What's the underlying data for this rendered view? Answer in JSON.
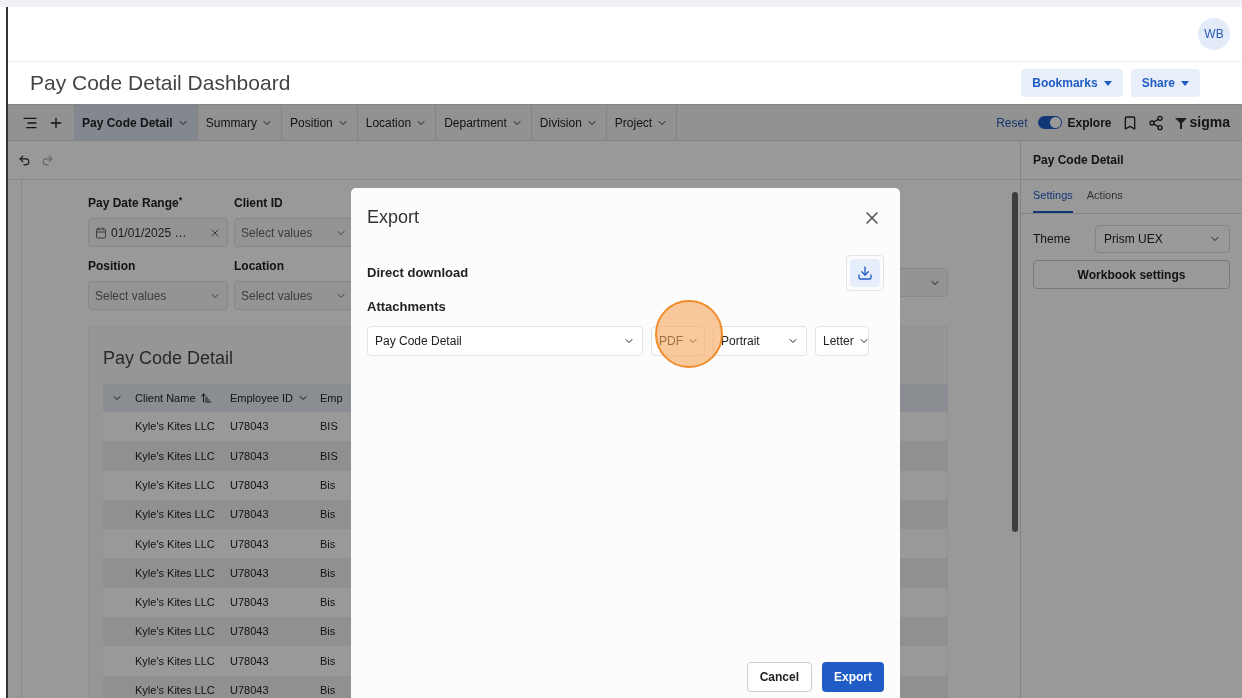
{
  "header": {
    "avatar": "WB"
  },
  "title": "Pay Code Detail Dashboard",
  "header_buttons": [
    "Bookmarks",
    "Share"
  ],
  "toolbar": {
    "tabs": [
      {
        "label": "Pay Code Detail",
        "selected": true
      },
      {
        "label": "Summary",
        "selected": false
      },
      {
        "label": "Position",
        "selected": false
      },
      {
        "label": "Location",
        "selected": false
      },
      {
        "label": "Department",
        "selected": false
      },
      {
        "label": "Division",
        "selected": false
      },
      {
        "label": "Project",
        "selected": false
      }
    ],
    "reset": "Reset",
    "explore": {
      "label": "Explore",
      "on": true
    },
    "logo": "sigma"
  },
  "filters": [
    {
      "kind": "date",
      "label": "Pay Date Range",
      "required_mark": "*",
      "value": "01/01/2025 …"
    },
    {
      "kind": "select",
      "label": "Client ID",
      "placeholder": "Select values"
    },
    {
      "kind": "select",
      "label": "Position",
      "placeholder": "Select values"
    },
    {
      "kind": "select",
      "label": "Location",
      "placeholder": "Select values"
    }
  ],
  "table": {
    "title": "Pay Code Detail",
    "columns": [
      {
        "kind": "menu"
      },
      {
        "kind": "sorted",
        "label": "Client Name"
      },
      {
        "kind": "menu",
        "label": "Employee ID"
      },
      {
        "kind": "plain",
        "label": "Emp"
      }
    ],
    "rows": [
      {
        "client_name": "Kyle's Kites LLC",
        "employee_id": "U78043",
        "column_4": "BIS"
      },
      {
        "client_name": "Kyle's Kites LLC",
        "employee_id": "U78043",
        "column_4": "BIS"
      },
      {
        "client_name": "Kyle's Kites LLC",
        "employee_id": "U78043",
        "column_4": "Bis"
      },
      {
        "client_name": "Kyle's Kites LLC",
        "employee_id": "U78043",
        "column_4": "Bis"
      },
      {
        "client_name": "Kyle's Kites LLC",
        "employee_id": "U78043",
        "column_4": "Bis"
      },
      {
        "client_name": "Kyle's Kites LLC",
        "employee_id": "U78043",
        "column_4": "Bis"
      },
      {
        "client_name": "Kyle's Kites LLC",
        "employee_id": "U78043",
        "column_4": "Bis"
      },
      {
        "client_name": "Kyle's Kites LLC",
        "employee_id": "U78043",
        "column_4": "Bis"
      },
      {
        "client_name": "Kyle's Kites LLC",
        "employee_id": "U78043",
        "column_4": "Bis"
      },
      {
        "client_name": "Kyle's Kites LLC",
        "employee_id": "U78043",
        "column_4": "Bis"
      }
    ]
  },
  "panel": {
    "title": "Pay Code Detail",
    "tabs": [
      {
        "label": "Settings",
        "selected": true
      },
      {
        "label": "Actions",
        "selected": false
      }
    ],
    "theme_label": "Theme",
    "theme_value": "Prism UEX",
    "button": "Workbook settings"
  },
  "dialog": {
    "title": "Export",
    "direct_download": "Direct download",
    "attachments": "Attachments",
    "selects": [
      {
        "kind": "wide",
        "value": "Pay Code Detail"
      },
      {
        "kind": "narrow",
        "value": "PDF"
      },
      {
        "kind": "medium",
        "value": "Portrait"
      },
      {
        "kind": "narrow",
        "value": "Letter"
      }
    ],
    "cancel": "Cancel",
    "export": "Export"
  }
}
